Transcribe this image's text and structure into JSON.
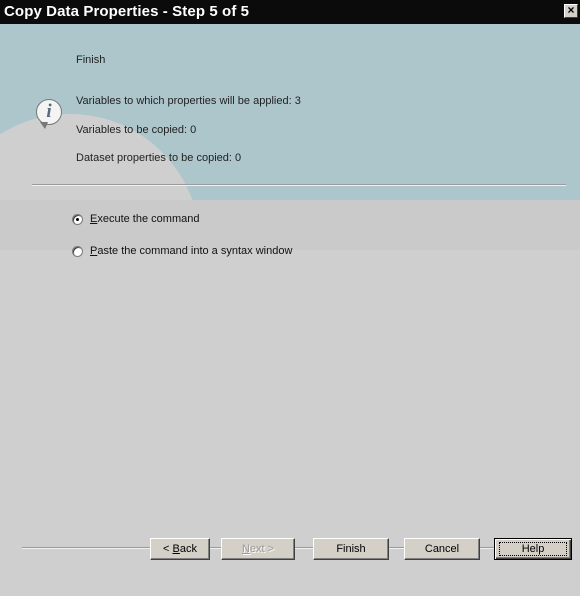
{
  "window": {
    "title": "Copy Data Properties - Step 5 of 5",
    "close_glyph": "×"
  },
  "summary": {
    "heading": "Finish",
    "info_icon": "info-icon",
    "lines": [
      "Variables to which properties will be applied: 3",
      "Variables to be copied: 0",
      "Dataset properties to be copied: 0"
    ]
  },
  "options": {
    "execute": {
      "underline": "E",
      "rest": "xecute the command",
      "checked": true
    },
    "paste": {
      "underline": "P",
      "rest": "aste the command into a syntax window",
      "checked": false
    }
  },
  "buttons": {
    "back_prefix": "< ",
    "back_underline": "B",
    "back_rest": "ack",
    "next_underline": "N",
    "next_rest": "ext >",
    "finish": "Finish",
    "cancel": "Cancel",
    "help": "Help"
  },
  "colors": {
    "titlebar": "#0b0b0b",
    "header_teal": "#adc6cc",
    "body_gray": "#cfcfcf"
  }
}
